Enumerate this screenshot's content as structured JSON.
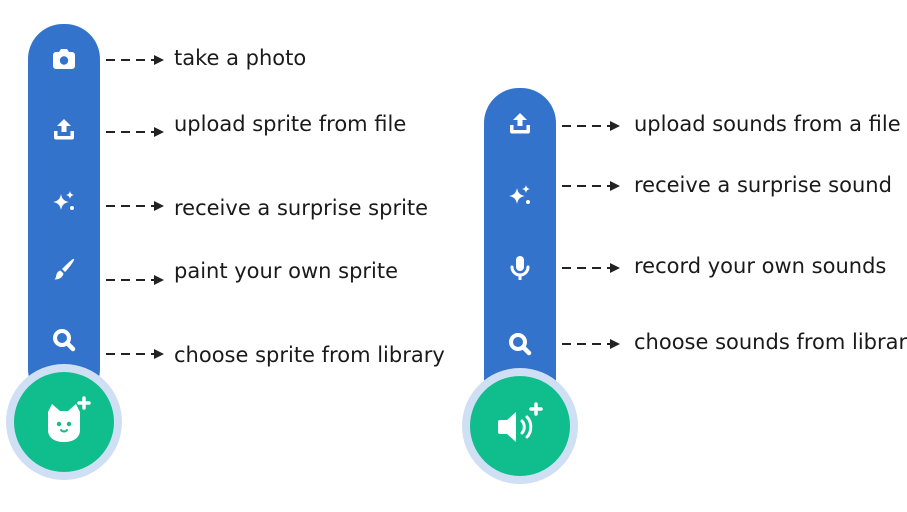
{
  "sprite_menu": {
    "items": [
      {
        "icon": "camera-icon",
        "label": "take a photo"
      },
      {
        "icon": "upload-icon",
        "label": "upload sprite from file"
      },
      {
        "icon": "surprise-sparkle-icon",
        "label": "receive a surprise sprite"
      },
      {
        "icon": "paintbrush-icon",
        "label": "paint your own sprite"
      },
      {
        "icon": "search-icon",
        "label": "choose sprite from library"
      }
    ],
    "main_button_icon": "cat-add-icon"
  },
  "sound_menu": {
    "items": [
      {
        "icon": "upload-icon",
        "label": "upload sounds from a file"
      },
      {
        "icon": "surprise-sparkle-icon",
        "label": "receive a surprise sound"
      },
      {
        "icon": "microphone-icon",
        "label": "record your own sounds"
      },
      {
        "icon": "search-icon",
        "label": "choose sounds from library"
      }
    ],
    "main_button_icon": "sound-add-icon"
  },
  "colors": {
    "menu_bar": "#3373cc",
    "main_button": "#10bd8c",
    "halo": "#cfe0f4",
    "icon": "#ffffff",
    "text": "#1a1a1a"
  }
}
